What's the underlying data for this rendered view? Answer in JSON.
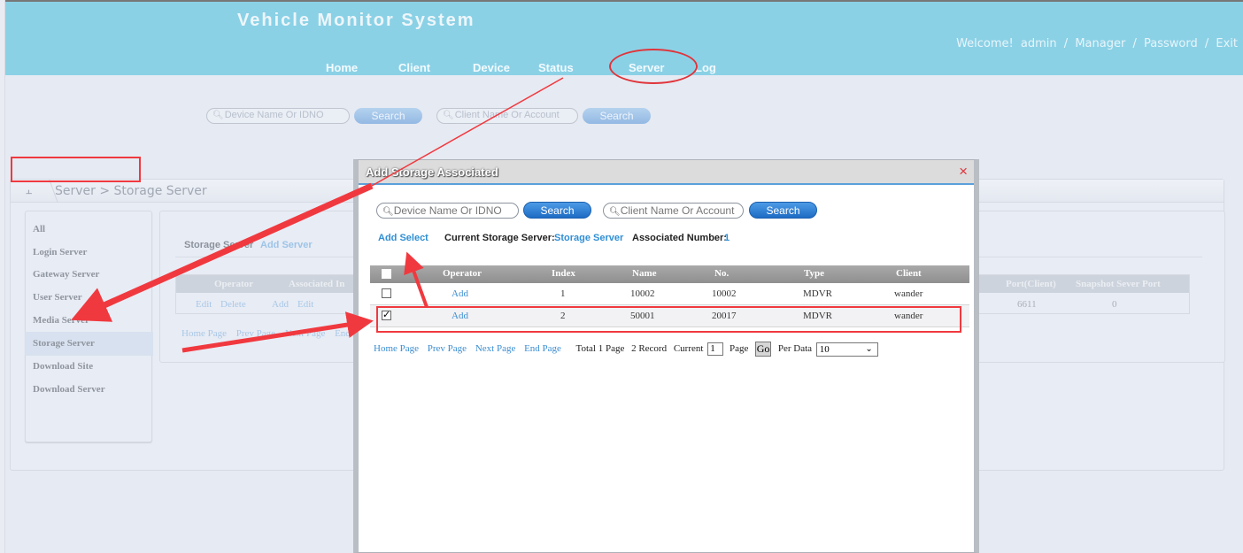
{
  "header": {
    "title": "Vehicle Monitor System",
    "welcome": "Welcome!",
    "user": "admin",
    "links": [
      "Manager",
      "Password",
      "Exit"
    ],
    "separator": "/",
    "nav": [
      "Home",
      "Client",
      "Device",
      "Status",
      "Server",
      "Log"
    ]
  },
  "top_search": {
    "device_placeholder": "Device Name Or IDNO",
    "client_placeholder": "Client Name Or Account",
    "search_label": "Search"
  },
  "breadcrumb": "Server > Storage Server",
  "sidebar": {
    "items": [
      "All",
      "Login Server",
      "Gateway Server",
      "User Server",
      "Media Server",
      "Storage Server",
      "Download Site",
      "Download Server"
    ],
    "active": "Storage Server"
  },
  "content": {
    "title": "Storage Server",
    "add_server": "Add Server",
    "columns": [
      "Operator",
      "Associated",
      "In",
      "Port(Client)",
      "Snapshot Sever Port"
    ],
    "row": {
      "operator": [
        "Edit",
        "Delete"
      ],
      "associated": [
        "Add",
        "Edit"
      ],
      "port_client": "6611",
      "snapshot_port": "0"
    },
    "pager": [
      "Home Page",
      "Prev Page",
      "Next Page",
      "End Page"
    ]
  },
  "modal": {
    "title": "Add Storage Associated",
    "close": "×",
    "device_placeholder": "Device Name Or IDNO",
    "client_placeholder": "Client Name Or Account",
    "search_label": "Search",
    "add_select": "Add Select",
    "current_label": "Current Storage Server:",
    "current_value": "Storage Server",
    "assoc_label": "Associated Number:",
    "assoc_value": "1",
    "columns": [
      "Operator",
      "Index",
      "Name",
      "No.",
      "Type",
      "Client"
    ],
    "rows": [
      {
        "checked": false,
        "operator": "Add",
        "index": "1",
        "name": "10002",
        "no": "10002",
        "type": "MDVR",
        "client": "wander"
      },
      {
        "checked": true,
        "operator": "Add",
        "index": "2",
        "name": "50001",
        "no": "20017",
        "type": "MDVR",
        "client": "wander"
      }
    ],
    "pager": {
      "links": [
        "Home Page",
        "Prev Page",
        "Next Page",
        "End Page"
      ],
      "total": "Total 1 Page",
      "records": "2 Record",
      "current_label": "Current",
      "current_value": "1",
      "page_label": "Page",
      "go": "Go",
      "per_label": "Per Data",
      "per_value": "10"
    }
  },
  "icons": {
    "search": "magnifier-icon",
    "breadcrumb": "server-icon",
    "check": "✓",
    "chevron": "⌄"
  },
  "colors": {
    "header_bg": "#8bd1e6",
    "annotation_red": "#f0393f",
    "link_blue": "#3c8ed1",
    "button_blue": "#1d6cc4"
  }
}
